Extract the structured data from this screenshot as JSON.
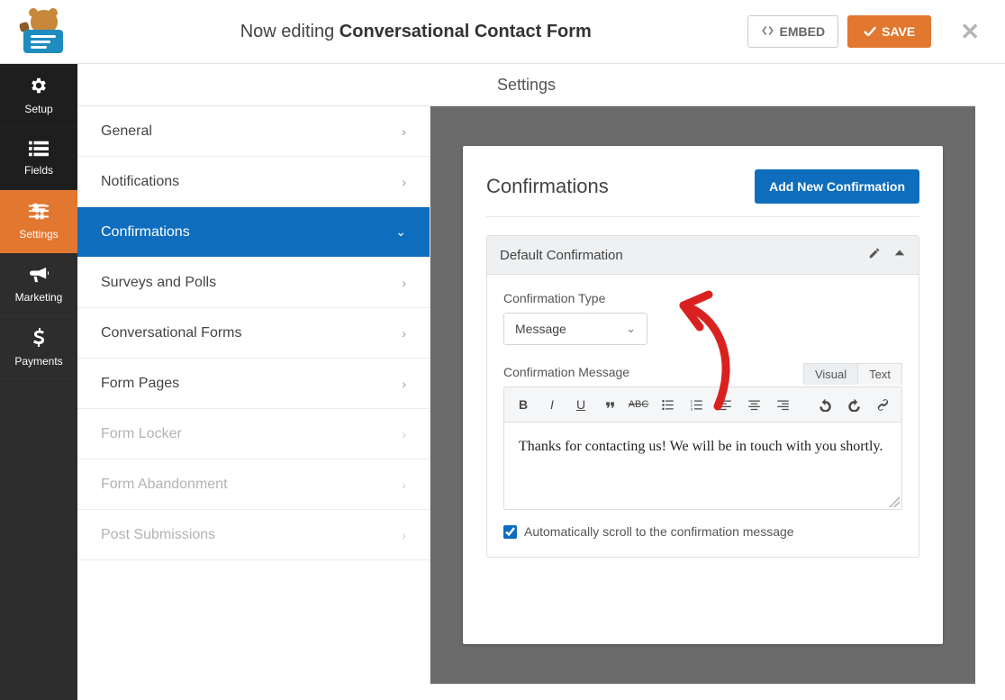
{
  "topbar": {
    "editing_prefix": "Now editing ",
    "form_name": "Conversational Contact Form",
    "embed_label": "EMBED",
    "save_label": "SAVE"
  },
  "rail": {
    "setup": "Setup",
    "fields": "Fields",
    "settings": "Settings",
    "marketing": "Marketing",
    "payments": "Payments"
  },
  "settings_header": "Settings",
  "subnav": {
    "general": "General",
    "notifications": "Notifications",
    "confirmations": "Confirmations",
    "surveys": "Surveys and Polls",
    "conversational": "Conversational Forms",
    "form_pages": "Form Pages",
    "form_locker": "Form Locker",
    "form_abandonment": "Form Abandonment",
    "post_submissions": "Post Submissions"
  },
  "panel": {
    "title": "Confirmations",
    "add_button": "Add New Confirmation",
    "accordion_title": "Default Confirmation",
    "type_label": "Confirmation Type",
    "type_value": "Message",
    "message_label": "Confirmation Message",
    "tabs": {
      "visual": "Visual",
      "text": "Text"
    },
    "message_value": "Thanks for contacting us! We will be in touch with you shortly.",
    "autoscroll_label": "Automatically scroll to the confirmation message",
    "autoscroll_checked": true
  }
}
